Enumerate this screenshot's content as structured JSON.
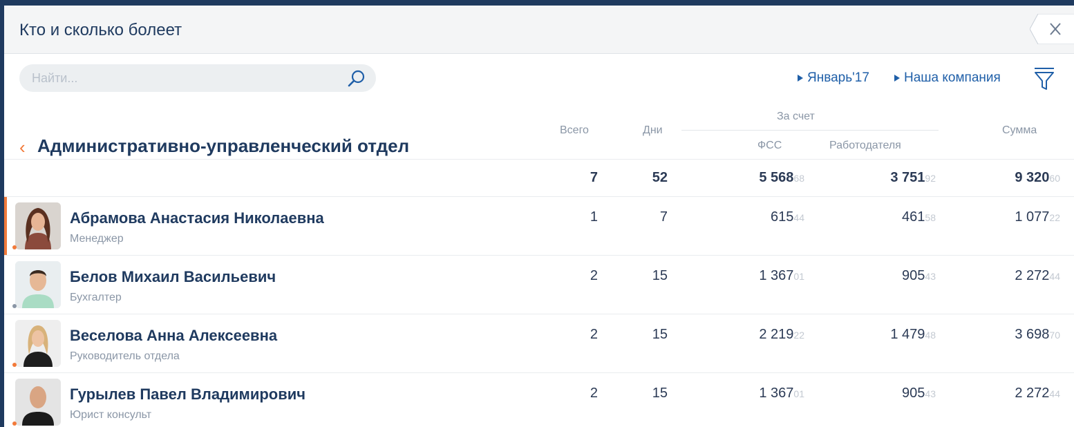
{
  "window": {
    "title": "Кто и сколько болеет"
  },
  "search": {
    "placeholder": "Найти..."
  },
  "filters": {
    "period": "Январь'17",
    "company": "Наша компания"
  },
  "department": {
    "title": "Административно-управленческий отдел"
  },
  "columns": {
    "total": "Всего",
    "days": "Дни",
    "paid_by": "За счет",
    "fss": "ФСС",
    "employer": "Работодателя",
    "sum": "Сумма"
  },
  "totals": {
    "total": "7",
    "days": "52",
    "fss": {
      "main": "5 568",
      "cents": "68"
    },
    "employer": {
      "main": "3 751",
      "cents": "92"
    },
    "sum": {
      "main": "9 320",
      "cents": "60"
    }
  },
  "employees": [
    {
      "name": "Абрамова Анастасия Николаевна",
      "role": "Менеджер",
      "total": "1",
      "days": "7",
      "fss": {
        "main": "615",
        "cents": "44"
      },
      "employer": {
        "main": "461",
        "cents": "58"
      },
      "sum": {
        "main": "1 077",
        "cents": "22"
      },
      "status_color": "#f27a3a"
    },
    {
      "name": "Белов Михаил Васильевич",
      "role": "Бухгалтер",
      "total": "2",
      "days": "15",
      "fss": {
        "main": "1 367",
        "cents": "01"
      },
      "employer": {
        "main": "905",
        "cents": "43"
      },
      "sum": {
        "main": "2 272",
        "cents": "44"
      },
      "status_color": "#8a96a6"
    },
    {
      "name": "Веселова Анна Алексеевна",
      "role": "Руководитель отдела",
      "total": "2",
      "days": "15",
      "fss": {
        "main": "2 219",
        "cents": "22"
      },
      "employer": {
        "main": "1 479",
        "cents": "48"
      },
      "sum": {
        "main": "3 698",
        "cents": "70"
      },
      "status_color": "#f27a3a"
    },
    {
      "name": "Гурылев Павел Владимирович",
      "role": "Юрист консульт",
      "total": "2",
      "days": "15",
      "fss": {
        "main": "1 367",
        "cents": "01"
      },
      "employer": {
        "main": "905",
        "cents": "43"
      },
      "sum": {
        "main": "2 272",
        "cents": "44"
      },
      "status_color": "#f27a3a"
    }
  ],
  "colors": {
    "accent": "#f27a3a",
    "title": "#1f3a5f",
    "link": "#1f5fa8",
    "muted": "#8a96a6"
  },
  "icons": {
    "close": "close-icon",
    "search": "search-icon",
    "filter": "funnel-icon",
    "back": "chevron-left-icon"
  }
}
